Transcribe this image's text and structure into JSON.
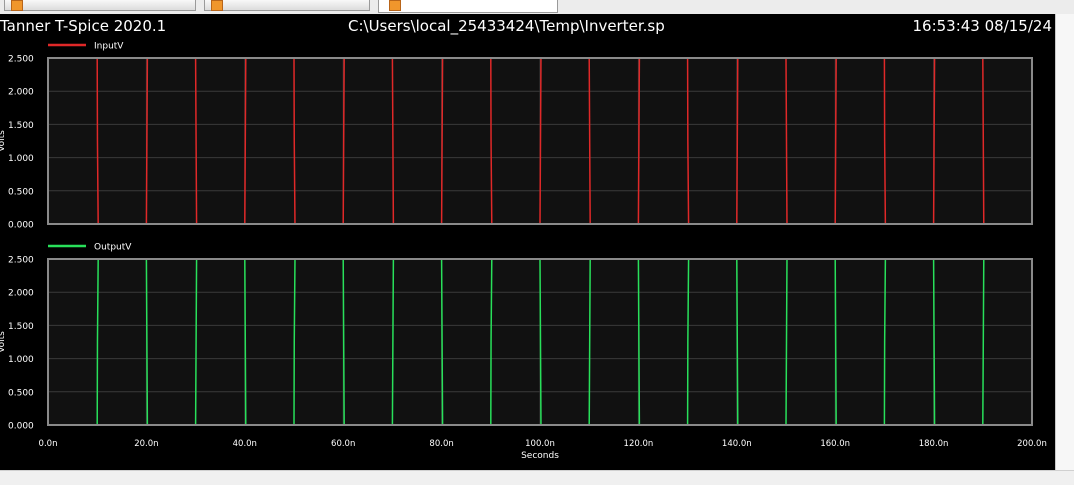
{
  "window": {
    "app_title": "Tanner T-Spice 2020.1",
    "file_path": "C:\\Users\\local_25433424\\Temp\\Inverter.sp",
    "timestamp": "16:53:43 08/15/24"
  },
  "colors": {
    "background": "#000000",
    "plot_area": "#111111",
    "grid": "#3a3a3a",
    "frame": "#8a8a8a",
    "input_trace": "#e02828",
    "output_trace": "#28e05a",
    "text": "#ffffff"
  },
  "chart_data": [
    {
      "type": "line",
      "ylabel": "Volts",
      "xlabel": "",
      "xlim": [
        0,
        200
      ],
      "ylim": [
        0,
        2.5
      ],
      "yticks": [
        "0.000",
        "0.500",
        "1.000",
        "1.500",
        "2.000",
        "2.500"
      ],
      "grid": true,
      "legend": "top-left",
      "series": [
        {
          "name": "InputV",
          "x": [
            0,
            10,
            10.05,
            10.2,
            20,
            20.2,
            30,
            30.2,
            40,
            40.2,
            50,
            50.05,
            50.2,
            60,
            60.2,
            70,
            70.2,
            80,
            80.2,
            90,
            90.05,
            90.2,
            100,
            100.2,
            110,
            110.2,
            120,
            120.2,
            130,
            130.05,
            130.2,
            140,
            140.2,
            150,
            150.2,
            160,
            160.2,
            170,
            170.05,
            170.2,
            180,
            180.2,
            190,
            190.2,
            200
          ],
          "y": [
            2.5,
            2.5,
            1.25,
            0,
            0,
            2.5,
            2.5,
            0,
            0,
            2.5,
            2.5,
            1.25,
            0,
            0,
            2.5,
            2.5,
            0,
            0,
            2.5,
            2.5,
            1.25,
            0,
            0,
            2.5,
            2.5,
            0,
            0,
            2.5,
            2.5,
            1.25,
            0,
            0,
            2.5,
            2.5,
            0,
            0,
            2.5,
            2.5,
            1.25,
            0,
            0,
            2.5,
            2.5,
            0,
            0
          ]
        }
      ]
    },
    {
      "type": "line",
      "ylabel": "Volts",
      "xlabel": "Seconds",
      "xlim": [
        0,
        200
      ],
      "ylim": [
        0,
        2.5
      ],
      "yticks": [
        "0.000",
        "0.500",
        "1.000",
        "1.500",
        "2.000",
        "2.500"
      ],
      "xticks": [
        "0.0n",
        "20.0n",
        "40.0n",
        "60.0n",
        "80.0n",
        "100.0n",
        "120.0n",
        "140.0n",
        "160.0n",
        "180.0n",
        "200.0n"
      ],
      "grid": true,
      "legend": "top-left",
      "series": [
        {
          "name": "OutputV",
          "x": [
            0,
            10,
            10.05,
            10.2,
            20,
            20.2,
            30,
            30.2,
            40,
            40.2,
            50,
            50.05,
            50.2,
            60,
            60.2,
            70,
            70.2,
            80,
            80.2,
            90,
            90.05,
            90.2,
            100,
            100.2,
            110,
            110.2,
            120,
            120.2,
            130,
            130.05,
            130.2,
            140,
            140.2,
            150,
            150.2,
            160,
            160.2,
            170,
            170.05,
            170.2,
            180,
            180.2,
            190,
            190.2,
            200
          ],
          "y": [
            0,
            0,
            1.25,
            2.5,
            2.5,
            0,
            0,
            2.5,
            2.5,
            0,
            0,
            1.25,
            2.5,
            2.5,
            0,
            0,
            2.5,
            2.5,
            0,
            0,
            1.25,
            2.5,
            2.5,
            0,
            0,
            2.5,
            2.5,
            0,
            0,
            1.25,
            2.5,
            2.5,
            0,
            0,
            2.5,
            2.5,
            0,
            0,
            1.25,
            2.5,
            2.5,
            0,
            0,
            2.5,
            2.5
          ]
        }
      ]
    }
  ]
}
